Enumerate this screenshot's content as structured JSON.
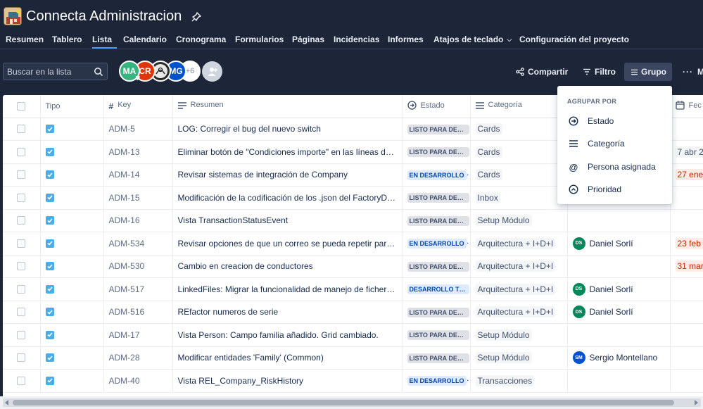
{
  "header": {
    "title": "Connecta Administracion",
    "tabs": [
      {
        "label": "Resumen",
        "active": false
      },
      {
        "label": "Tablero",
        "active": false
      },
      {
        "label": "Lista",
        "active": true
      },
      {
        "label": "Calendario",
        "active": false
      },
      {
        "label": "Cronograma",
        "active": false
      },
      {
        "label": "Formularios",
        "active": false
      },
      {
        "label": "Páginas",
        "active": false
      },
      {
        "label": "Incidencias",
        "active": false
      },
      {
        "label": "Informes",
        "active": false
      },
      {
        "label": "Atajos de teclado",
        "active": false,
        "has_chevron": true
      },
      {
        "label": "Configuración del proyecto",
        "active": false
      }
    ]
  },
  "toolbar": {
    "search_placeholder": "Buscar en la lista",
    "avatars": [
      {
        "initials": "MA",
        "sub": "M",
        "color": "#36b37e"
      },
      {
        "initials": "CR",
        "color": "#de350b"
      },
      {
        "initials": "",
        "color": "#2b2b2b",
        "image_like": true
      },
      {
        "initials": "MG",
        "color": "#0052cc"
      }
    ],
    "more_avatars": "+6",
    "share_label": "Compartir",
    "filter_label": "Filtro",
    "group_label": "Grupo",
    "more_label": "M"
  },
  "table": {
    "columns": {
      "tipo": "Tipo",
      "key": "Key",
      "resumen": "Resumen",
      "estado": "Estado",
      "categoria": "Categoría",
      "fecha": "Fec"
    },
    "rows": [
      {
        "key": "ADM-5",
        "summary": "LOG: Corregir el bug del nuevo switch",
        "status": "LISTO PARA DESA...",
        "status_color": "grey",
        "category": "Cards",
        "assignee": null,
        "date": null,
        "expandable": false
      },
      {
        "key": "ADM-13",
        "summary": "Eliminar botón de \"Condiciones importe\" en las líneas de tarif...",
        "status": "LISTO PARA DESA...",
        "status_color": "grey",
        "category": "Cards",
        "assignee": null,
        "date": "7 abr 20",
        "date_style": "plain",
        "expandable": false
      },
      {
        "key": "ADM-14",
        "summary": "Revisar sistemas de integración de Company",
        "status": "EN DESARROLLO",
        "status_color": "blue",
        "category": "Cards",
        "assignee": null,
        "date": "27 ene",
        "date_style": "red",
        "expandable": false
      },
      {
        "key": "ADM-15",
        "summary": "Modificación de la codificación de los .json del FactoryData",
        "status": "LISTO PARA DESA...",
        "status_color": "grey",
        "category": "Inbox",
        "assignee": null,
        "date": null,
        "expandable": false
      },
      {
        "key": "ADM-16",
        "summary": "Vista TransactionStatusEvent",
        "status": "LISTO PARA DESA...",
        "status_color": "grey",
        "category": "Setup Módulo",
        "assignee": null,
        "date": null,
        "expandable": false
      },
      {
        "key": "ADM-534",
        "summary": "Revisar opciones de que un correo se pueda repetir para difer...",
        "status": "EN DESARROLLO",
        "status_color": "blue",
        "category": "Arquitectura + I+D+I",
        "assignee": {
          "initials": "DS",
          "name": "Daniel Sorlí",
          "color": "#00875a"
        },
        "date": "23 feb 2",
        "date_style": "red",
        "expandable": false
      },
      {
        "key": "ADM-530",
        "summary": "Cambio en creacion de conductores",
        "status": "LISTO PARA DESA...",
        "status_color": "grey",
        "category": "Arquitectura + I+D+I",
        "assignee": null,
        "date": "31 mar",
        "date_style": "red",
        "expandable": false
      },
      {
        "key": "ADM-517",
        "summary": "LinkedFiles: Migrar la funcionalidad de manejo de ficheros a ...",
        "status": "DESARROLLO TER...",
        "status_color": "blue",
        "category": "Arquitectura + I+D+I",
        "assignee": {
          "initials": "DS",
          "name": "Daniel Sorlí",
          "color": "#00875a"
        },
        "date": null,
        "expandable": false
      },
      {
        "key": "ADM-516",
        "summary": "REfactor numeros de serie",
        "status": "LISTO PARA DESA...",
        "status_color": "grey",
        "category": "Arquitectura + I+D+I",
        "assignee": {
          "initials": "DS",
          "name": "Daniel Sorlí",
          "color": "#00875a"
        },
        "date": null,
        "expandable": false
      },
      {
        "key": "ADM-17",
        "summary": "Vista Person: Campo familia añadido. Grid cambiado.",
        "status": "LISTO PARA DESA...",
        "status_color": "grey",
        "category": "Setup Módulo",
        "assignee": null,
        "date": null,
        "expandable": false
      },
      {
        "key": "ADM-28",
        "summary": "Modificar entidades 'Family' (Common)",
        "status": "LISTO PARA DESA...",
        "status_color": "grey",
        "category": "Setup Módulo",
        "assignee": {
          "initials": "SM",
          "name": "Sergio Montellano",
          "color": "#0052cc"
        },
        "date": null,
        "expandable": false
      },
      {
        "key": "ADM-40",
        "summary": "Vista REL_Company_RiskHistory",
        "status": "EN DESARROLLO",
        "status_color": "blue",
        "category": "Transacciones",
        "assignee": null,
        "date": null,
        "expandable": true
      }
    ]
  },
  "group_menu": {
    "heading": "AGRUPAR POR",
    "items": [
      {
        "label": "Estado",
        "icon": "status-arrow-icon"
      },
      {
        "label": "Categoría",
        "icon": "lines-icon"
      },
      {
        "label": "Persona asignada",
        "icon": "at-sign-icon"
      },
      {
        "label": "Prioridad",
        "icon": "priority-chevron-icon"
      }
    ]
  }
}
